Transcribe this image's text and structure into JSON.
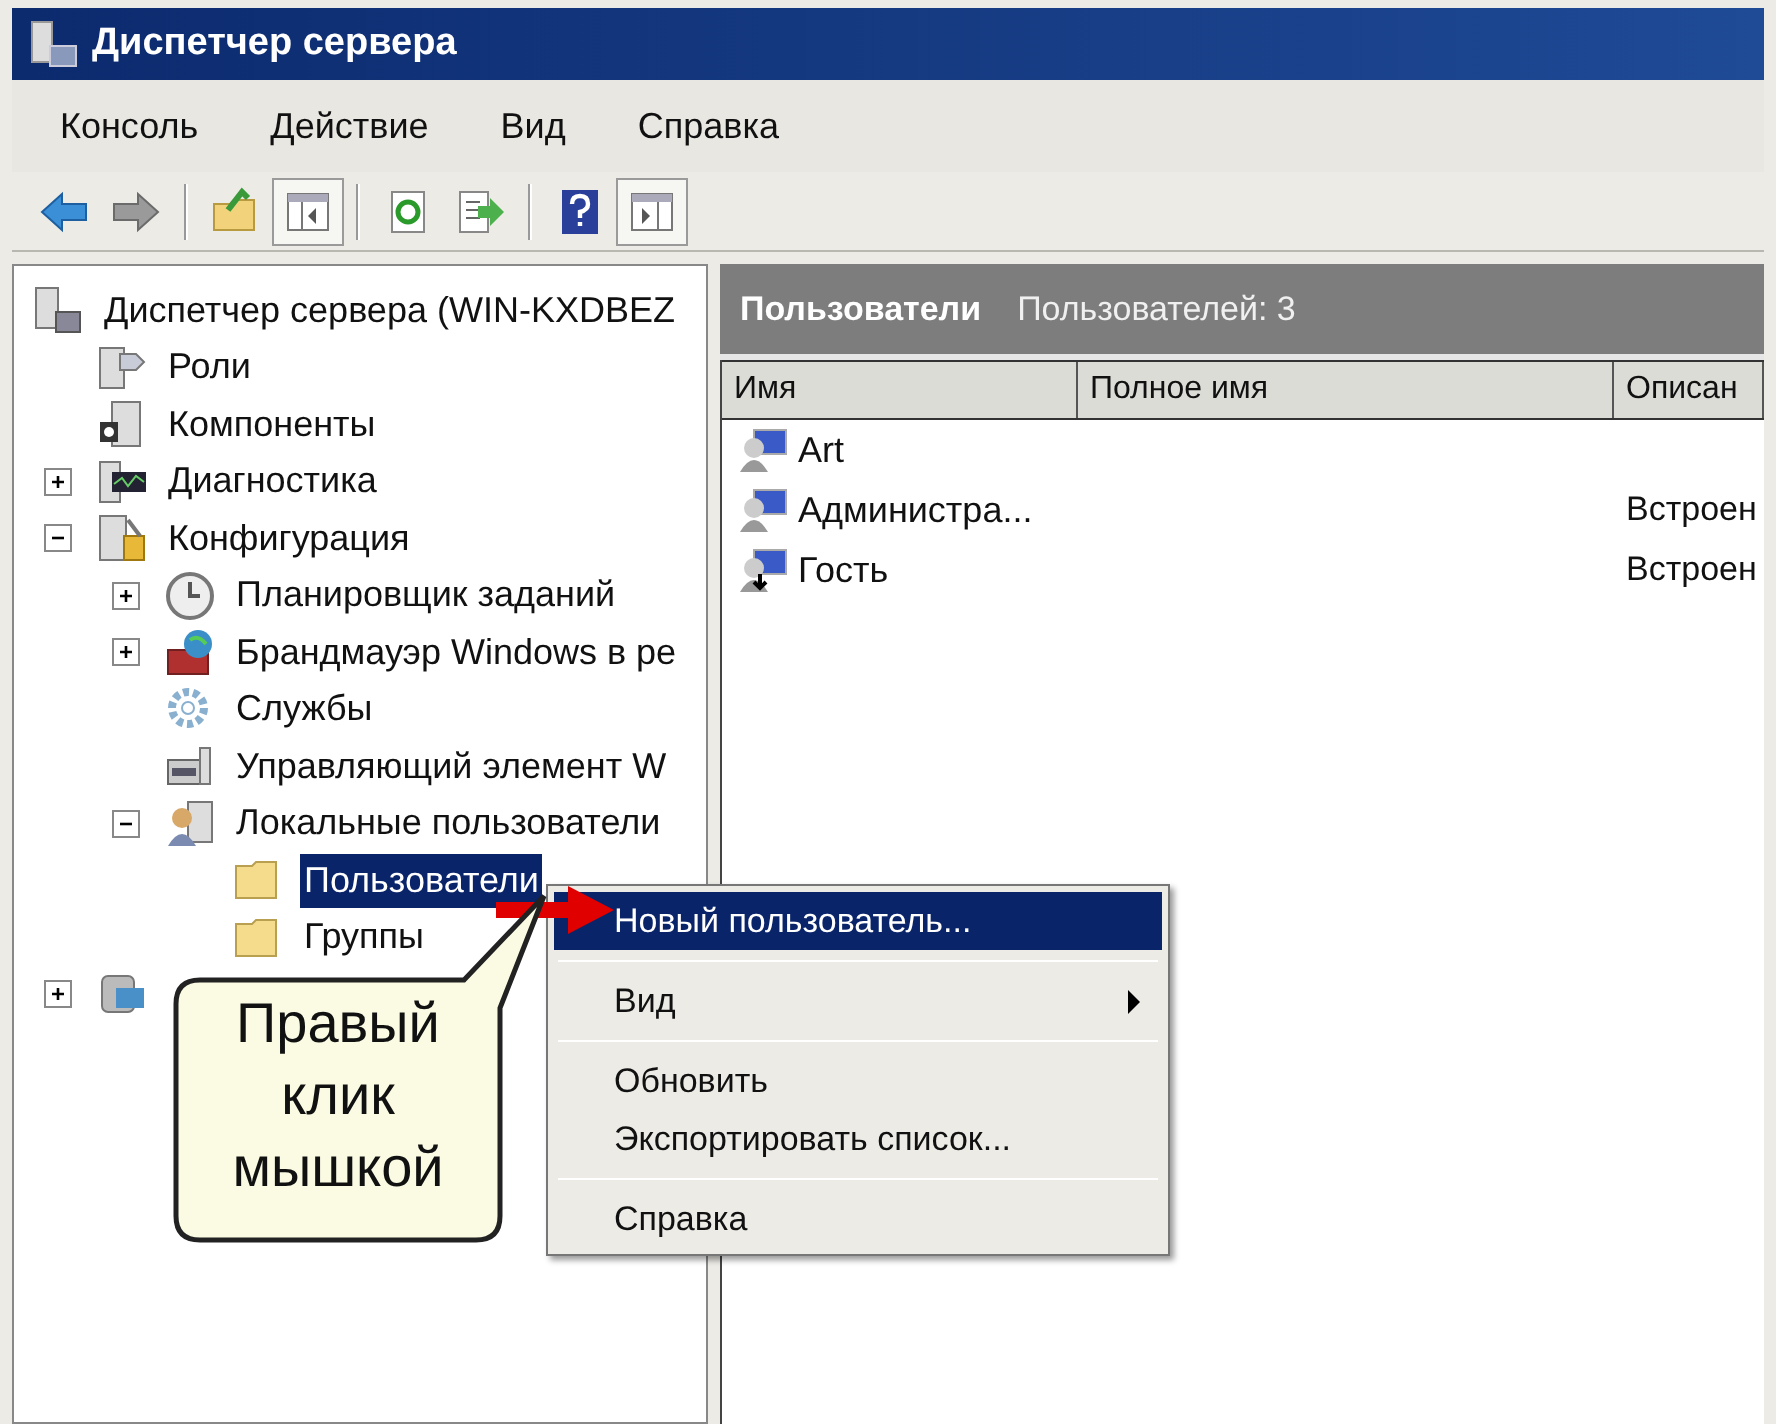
{
  "window": {
    "title": "Диспетчер сервера"
  },
  "menu": [
    "Консоль",
    "Действие",
    "Вид",
    "Справка"
  ],
  "toolbar": {
    "groups": [
      {
        "buttons": [
          {
            "pressed": false
          },
          {
            "pressed": false
          }
        ]
      },
      {
        "buttons": [
          {
            "pressed": false
          },
          {
            "pressed": true
          }
        ]
      },
      {
        "buttons": [
          {
            "pressed": false
          },
          {
            "pressed": false
          }
        ]
      },
      {
        "buttons": [
          {
            "pressed": false
          },
          {
            "pressed": true
          }
        ]
      }
    ]
  },
  "tree": {
    "label": "Диспетчер сервера (WIN-KXDBEZ",
    "selected": false,
    "children": [
      {
        "label": "Роли",
        "selected": false
      },
      {
        "label": "Компоненты",
        "selected": false
      },
      {
        "label": "Диагностика",
        "selected": false,
        "expanded": false
      },
      {
        "label": "Конфигурация",
        "selected": false,
        "expanded": true,
        "children": [
          {
            "label": "Планировщик заданий",
            "selected": false,
            "expanded": false
          },
          {
            "label": "Брандмауэр Windows в ре",
            "selected": false,
            "expanded": false
          },
          {
            "label": "Службы",
            "selected": false
          },
          {
            "label": "Управляющий элемент W",
            "selected": false
          },
          {
            "label": "Локальные пользователи",
            "selected": false,
            "expanded": true,
            "children": [
              {
                "label": "Пользователи",
                "selected": true
              },
              {
                "label": "Группы",
                "selected": false
              }
            ]
          }
        ]
      },
      {
        "selected": false,
        "expanded": false
      }
    ]
  },
  "details": {
    "title": "Пользователи",
    "subtitle": "Пользователей: 3",
    "columns": [
      "Имя",
      "Полное имя",
      "Описан"
    ],
    "rows": [
      {
        "name": "Art"
      },
      {
        "name": "Администра...",
        "description": "Встроен"
      },
      {
        "name": "Гость",
        "description": "Встроен"
      }
    ]
  },
  "context_menu": {
    "groups": [
      [
        {
          "label": "Новый пользователь...",
          "selected": true,
          "has_submenu": false
        }
      ],
      [
        {
          "label": "Вид",
          "selected": false,
          "has_submenu": true
        }
      ],
      [
        {
          "label": "Обновить",
          "selected": false,
          "has_submenu": false
        },
        {
          "label": "Экспортировать список...",
          "selected": false,
          "has_submenu": false
        }
      ],
      [
        {
          "label": "Справка",
          "selected": false,
          "has_submenu": false
        }
      ]
    ]
  },
  "callout": {
    "text": "Правый клик мышкой"
  }
}
